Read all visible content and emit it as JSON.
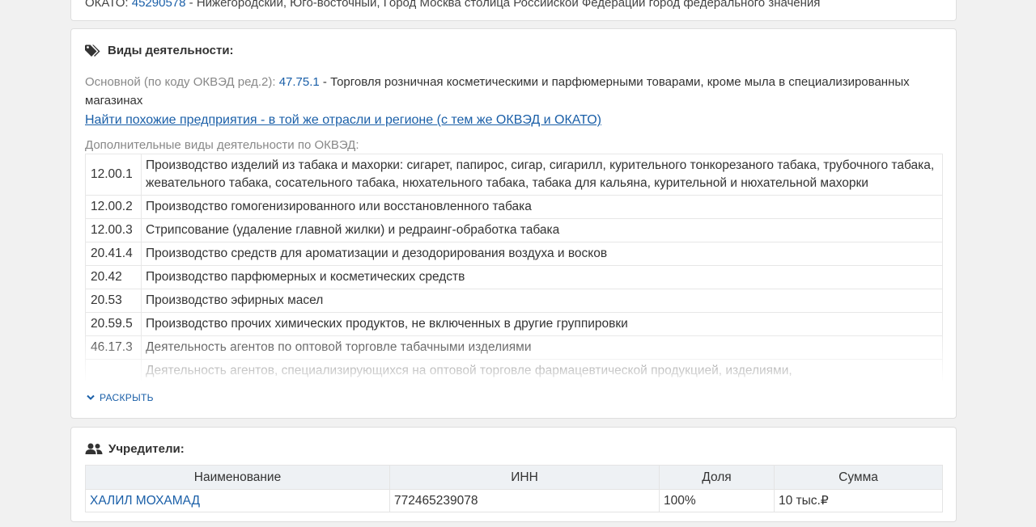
{
  "top_card": {
    "okato_label": "ОКАТО:",
    "okato_code": "45290578",
    "okato_text": "- Нижегородский, Юго-восточный, Город Москва столица Российской Федерации город федерального значения"
  },
  "activities": {
    "title": "Виды деятельности:",
    "main_label": "Основной (по коду ОКВЭД ред.2):",
    "main_code": "47.75.1",
    "main_text": "- Торговля розничная косметическими и парфюмерными товарами, кроме мыла в специализированных магазинах",
    "similar_link": "Найти похожие предприятия - в той же отрасли и регионе (с тем же ОКВЭД и ОКАТО)",
    "extra_label": "Дополнительные виды деятельности по ОКВЭД:",
    "rows": [
      {
        "code": "12.00.1",
        "text": "Производство изделий из табака и махорки: сигарет, папирос, сигар, сигарилл, курительного тонкорезаного табака, трубочного табака, жевательного табака, сосательного табака, нюхательного табака, табака для кальяна, курительной и нюхательной махорки"
      },
      {
        "code": "12.00.2",
        "text": "Производство гомогенизированного или восстановленного табака"
      },
      {
        "code": "12.00.3",
        "text": "Стрипсование (удаление главной жилки) и редраинг-обработка табака"
      },
      {
        "code": "20.41.4",
        "text": "Производство средств для ароматизации и дезодорирования воздуха и восков"
      },
      {
        "code": "20.42",
        "text": "Производство парфюмерных и косметических средств"
      },
      {
        "code": "20.53",
        "text": "Производство эфирных масел"
      },
      {
        "code": "20.59.5",
        "text": "Производство прочих химических продуктов, не включенных в другие группировки"
      },
      {
        "code": "46.17.3",
        "text": "Деятельность агентов по оптовой торговле табачными изделиями"
      },
      {
        "code": "",
        "text": "Деятельность агентов, специализирующихся на оптовой торговле фармацевтической продукцией, изделиями,"
      }
    ],
    "expand_label": "РАСКРЫТЬ"
  },
  "founders": {
    "title": "Учредители:",
    "headers": [
      "Наименование",
      "ИНН",
      "Доля",
      "Сумма"
    ],
    "rows": [
      {
        "name": "ХАЛИЛ МОХАМАД",
        "inn": "772465239078",
        "share": "100%",
        "sum": "10 тыс.₽"
      }
    ]
  },
  "colors": {
    "link": "#1a5fa8",
    "muted": "#888888",
    "background": "#f1f1f1"
  }
}
